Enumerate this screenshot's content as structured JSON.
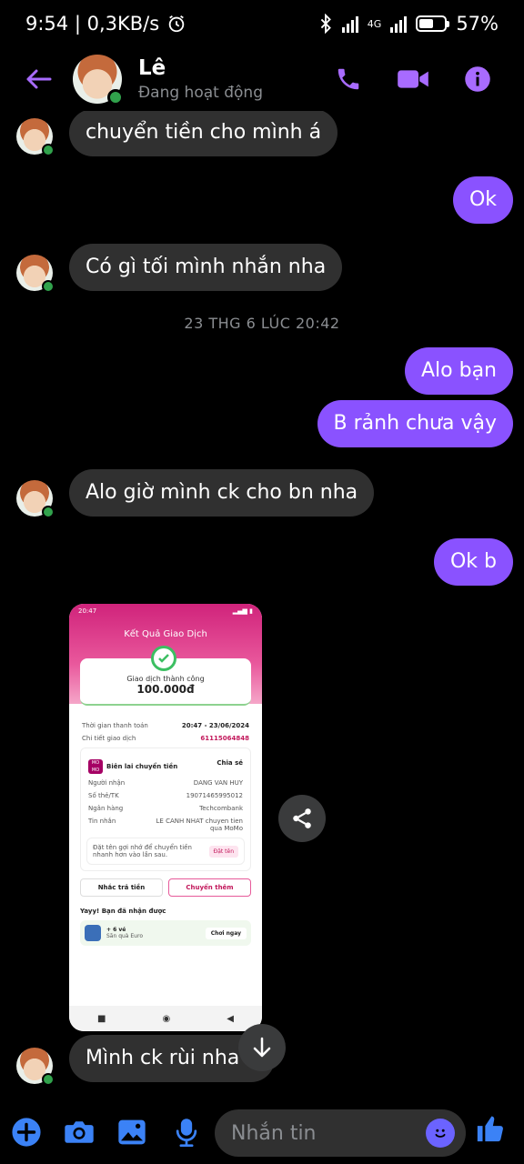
{
  "status_bar": {
    "time_speed": "9:54 | 0,3KB/s",
    "network": "4G",
    "battery_percent_label": "57%",
    "battery_level": 0.57
  },
  "header": {
    "name": "Lê",
    "status": "Đang hoạt động"
  },
  "messages": [
    {
      "side": "in",
      "text": "chuyển tiền cho mình á"
    },
    {
      "side": "out",
      "text": "Ok"
    },
    {
      "side": "in",
      "text": "Có gì tối mình nhắn nha"
    },
    {
      "side": "out",
      "text": "Alo bạn"
    },
    {
      "side": "out",
      "text": "B rảnh chưa vậy"
    },
    {
      "side": "in",
      "text": "Alo giờ mình ck cho bn nha"
    },
    {
      "side": "out",
      "text": "Ok b"
    },
    {
      "side": "in",
      "text": "Mình ck rùi nha b"
    }
  ],
  "timestamp": "23 THG 6 LÚC 20:42",
  "shared_image": {
    "status_time": "20:47",
    "title": "Kết Quả Giao Dịch",
    "result": "Giao dịch thành công",
    "amount": "100.000đ",
    "rows": [
      {
        "label": "Thời gian thanh toán",
        "value": "20:47 - 23/06/2024"
      },
      {
        "label": "Chi tiết giao dịch",
        "value": "61115064848"
      }
    ],
    "receipt_label": "Biên lai chuyển tiền",
    "share_label": "Chia sẻ",
    "details": [
      {
        "label": "Người nhận",
        "value": "DANG VAN HUY"
      },
      {
        "label": "Số thẻ/TK",
        "value": "19071465995012"
      },
      {
        "label": "Ngân hàng",
        "value": "Techcombank"
      },
      {
        "label": "Tin nhắn",
        "value": "LE CANH NHAT chuyen tien qua MoMo"
      }
    ],
    "tip": "Đặt tên gợi nhớ để chuyển tiền nhanh hơn vào lần sau.",
    "tip_button": "Đặt tên",
    "btn_remind": "Nhắc trả tiền",
    "btn_more": "Chuyển thêm",
    "reward_title": "Yayy! Bạn đã nhận được",
    "reward_item": "+ 6 vé",
    "reward_sub": "Săn quà Euro",
    "reward_btn": "Chơi ngay"
  },
  "composer": {
    "placeholder": "Nhắn tin"
  },
  "colors": {
    "accent": "#8a52ff",
    "incoming_bubble": "#303030",
    "online": "#31a24c"
  }
}
